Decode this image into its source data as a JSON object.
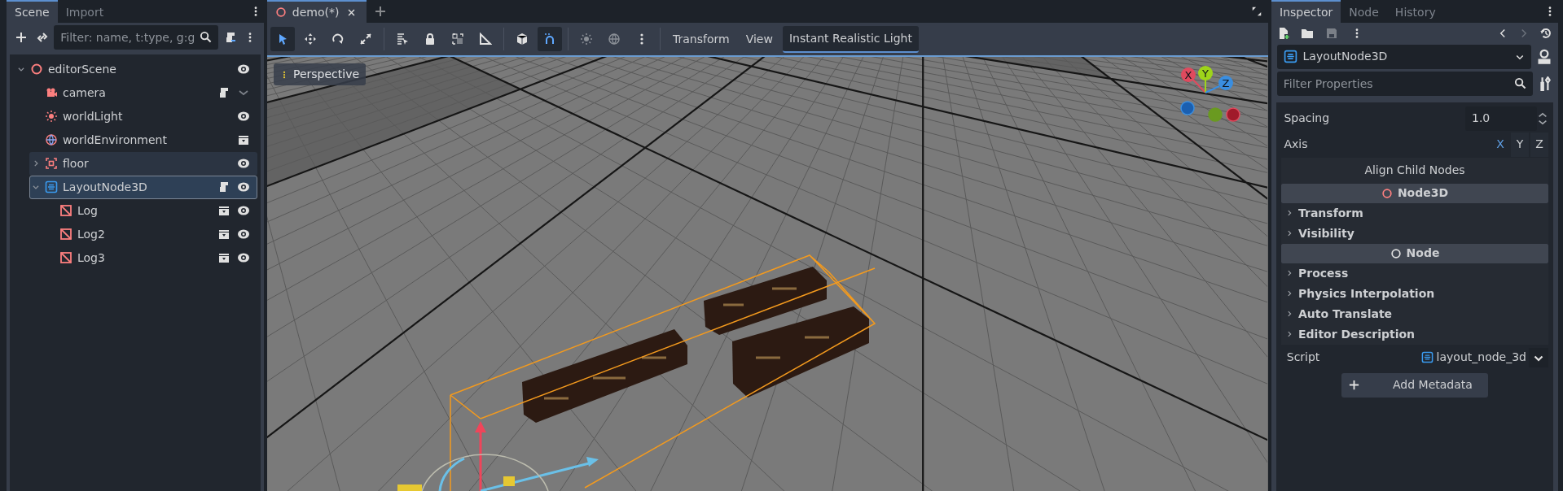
{
  "scene_dock": {
    "tabs": [
      {
        "label": "Scene",
        "selected": true
      },
      {
        "label": "Import",
        "selected": false
      }
    ],
    "filter": {
      "placeholder": "Filter: name, t:type, g:g"
    },
    "tree": [
      {
        "kind": "root",
        "label": "editorScene",
        "expanded": true,
        "selected": false,
        "hovered": false,
        "script": false,
        "instanced": false,
        "children": [
          {
            "kind": "camera",
            "label": "camera",
            "selected": false,
            "hovered": false,
            "script": true,
            "instanced": false
          },
          {
            "kind": "light",
            "label": "worldLight",
            "selected": false,
            "hovered": false,
            "script": false,
            "instanced": false
          },
          {
            "kind": "environment",
            "label": "worldEnvironment",
            "selected": false,
            "hovered": false,
            "script": false,
            "instanced": true
          },
          {
            "kind": "mesh",
            "label": "floor",
            "expanded": false,
            "selected": false,
            "hovered": true,
            "script": false,
            "instanced": false
          },
          {
            "kind": "layout",
            "label": "LayoutNode3D",
            "expanded": true,
            "selected": true,
            "hovered": false,
            "script": true,
            "instanced": false,
            "children": [
              {
                "kind": "log",
                "label": "Log",
                "selected": false,
                "hovered": false,
                "script": false,
                "instanced": true
              },
              {
                "kind": "log",
                "label": "Log2",
                "selected": false,
                "hovered": false,
                "script": false,
                "instanced": true
              },
              {
                "kind": "log",
                "label": "Log3",
                "selected": false,
                "hovered": false,
                "script": false,
                "instanced": true
              }
            ]
          }
        ]
      }
    ]
  },
  "editor": {
    "tabs": [
      {
        "label": "demo(*)",
        "selected": true
      }
    ],
    "tool_groups": [
      [
        {
          "kind": "select",
          "selected": true
        },
        {
          "kind": "move",
          "selected": false
        },
        {
          "kind": "rotate",
          "selected": false
        },
        {
          "kind": "scale",
          "selected": false
        }
      ],
      [
        {
          "kind": "list",
          "selected": false
        },
        {
          "kind": "lock",
          "selected": false
        },
        {
          "kind": "group",
          "selected": false
        },
        {
          "kind": "ruler",
          "selected": false
        }
      ],
      [
        {
          "kind": "cube",
          "selected": false
        },
        {
          "kind": "magnet",
          "selected": true
        }
      ],
      [
        {
          "kind": "sun",
          "selected": false
        },
        {
          "kind": "globe",
          "selected": false
        },
        {
          "kind": "more",
          "selected": false
        }
      ]
    ],
    "menus": [
      {
        "label": "Transform",
        "selected": false
      },
      {
        "label": "View",
        "selected": false
      },
      {
        "label": "Instant Realistic Light",
        "selected": true
      }
    ],
    "viewport": {
      "view_button": "Perspective",
      "gizmo": [
        "X",
        "Y",
        "Z"
      ]
    }
  },
  "inspector": {
    "tabs": [
      {
        "label": "Inspector",
        "selected": true
      },
      {
        "label": "Node",
        "selected": false
      },
      {
        "label": "History",
        "selected": false
      }
    ],
    "object": "LayoutNode3D",
    "filter": {
      "placeholder": "Filter Properties"
    },
    "properties": [
      {
        "kind": "number",
        "label": "Spacing",
        "value": "1.0"
      },
      {
        "kind": "axis",
        "label": "Axis",
        "options": [
          {
            "label": "X",
            "selected": true
          },
          {
            "label": "Y",
            "selected": false
          },
          {
            "label": "Z",
            "selected": false
          }
        ]
      },
      {
        "kind": "button",
        "label": "Align Child Nodes"
      },
      {
        "kind": "header3d",
        "label": "Node3D"
      },
      {
        "kind": "group",
        "label": "Transform"
      },
      {
        "kind": "group",
        "label": "Visibility"
      },
      {
        "kind": "header",
        "label": "Node"
      },
      {
        "kind": "group",
        "label": "Process"
      },
      {
        "kind": "group",
        "label": "Physics Interpolation"
      },
      {
        "kind": "group",
        "label": "Auto Translate"
      },
      {
        "kind": "group",
        "label": "Editor Description"
      },
      {
        "kind": "resource",
        "label": "Script",
        "value": "layout_node_3d"
      },
      {
        "kind": "add",
        "label": "Add Metadata"
      }
    ]
  }
}
